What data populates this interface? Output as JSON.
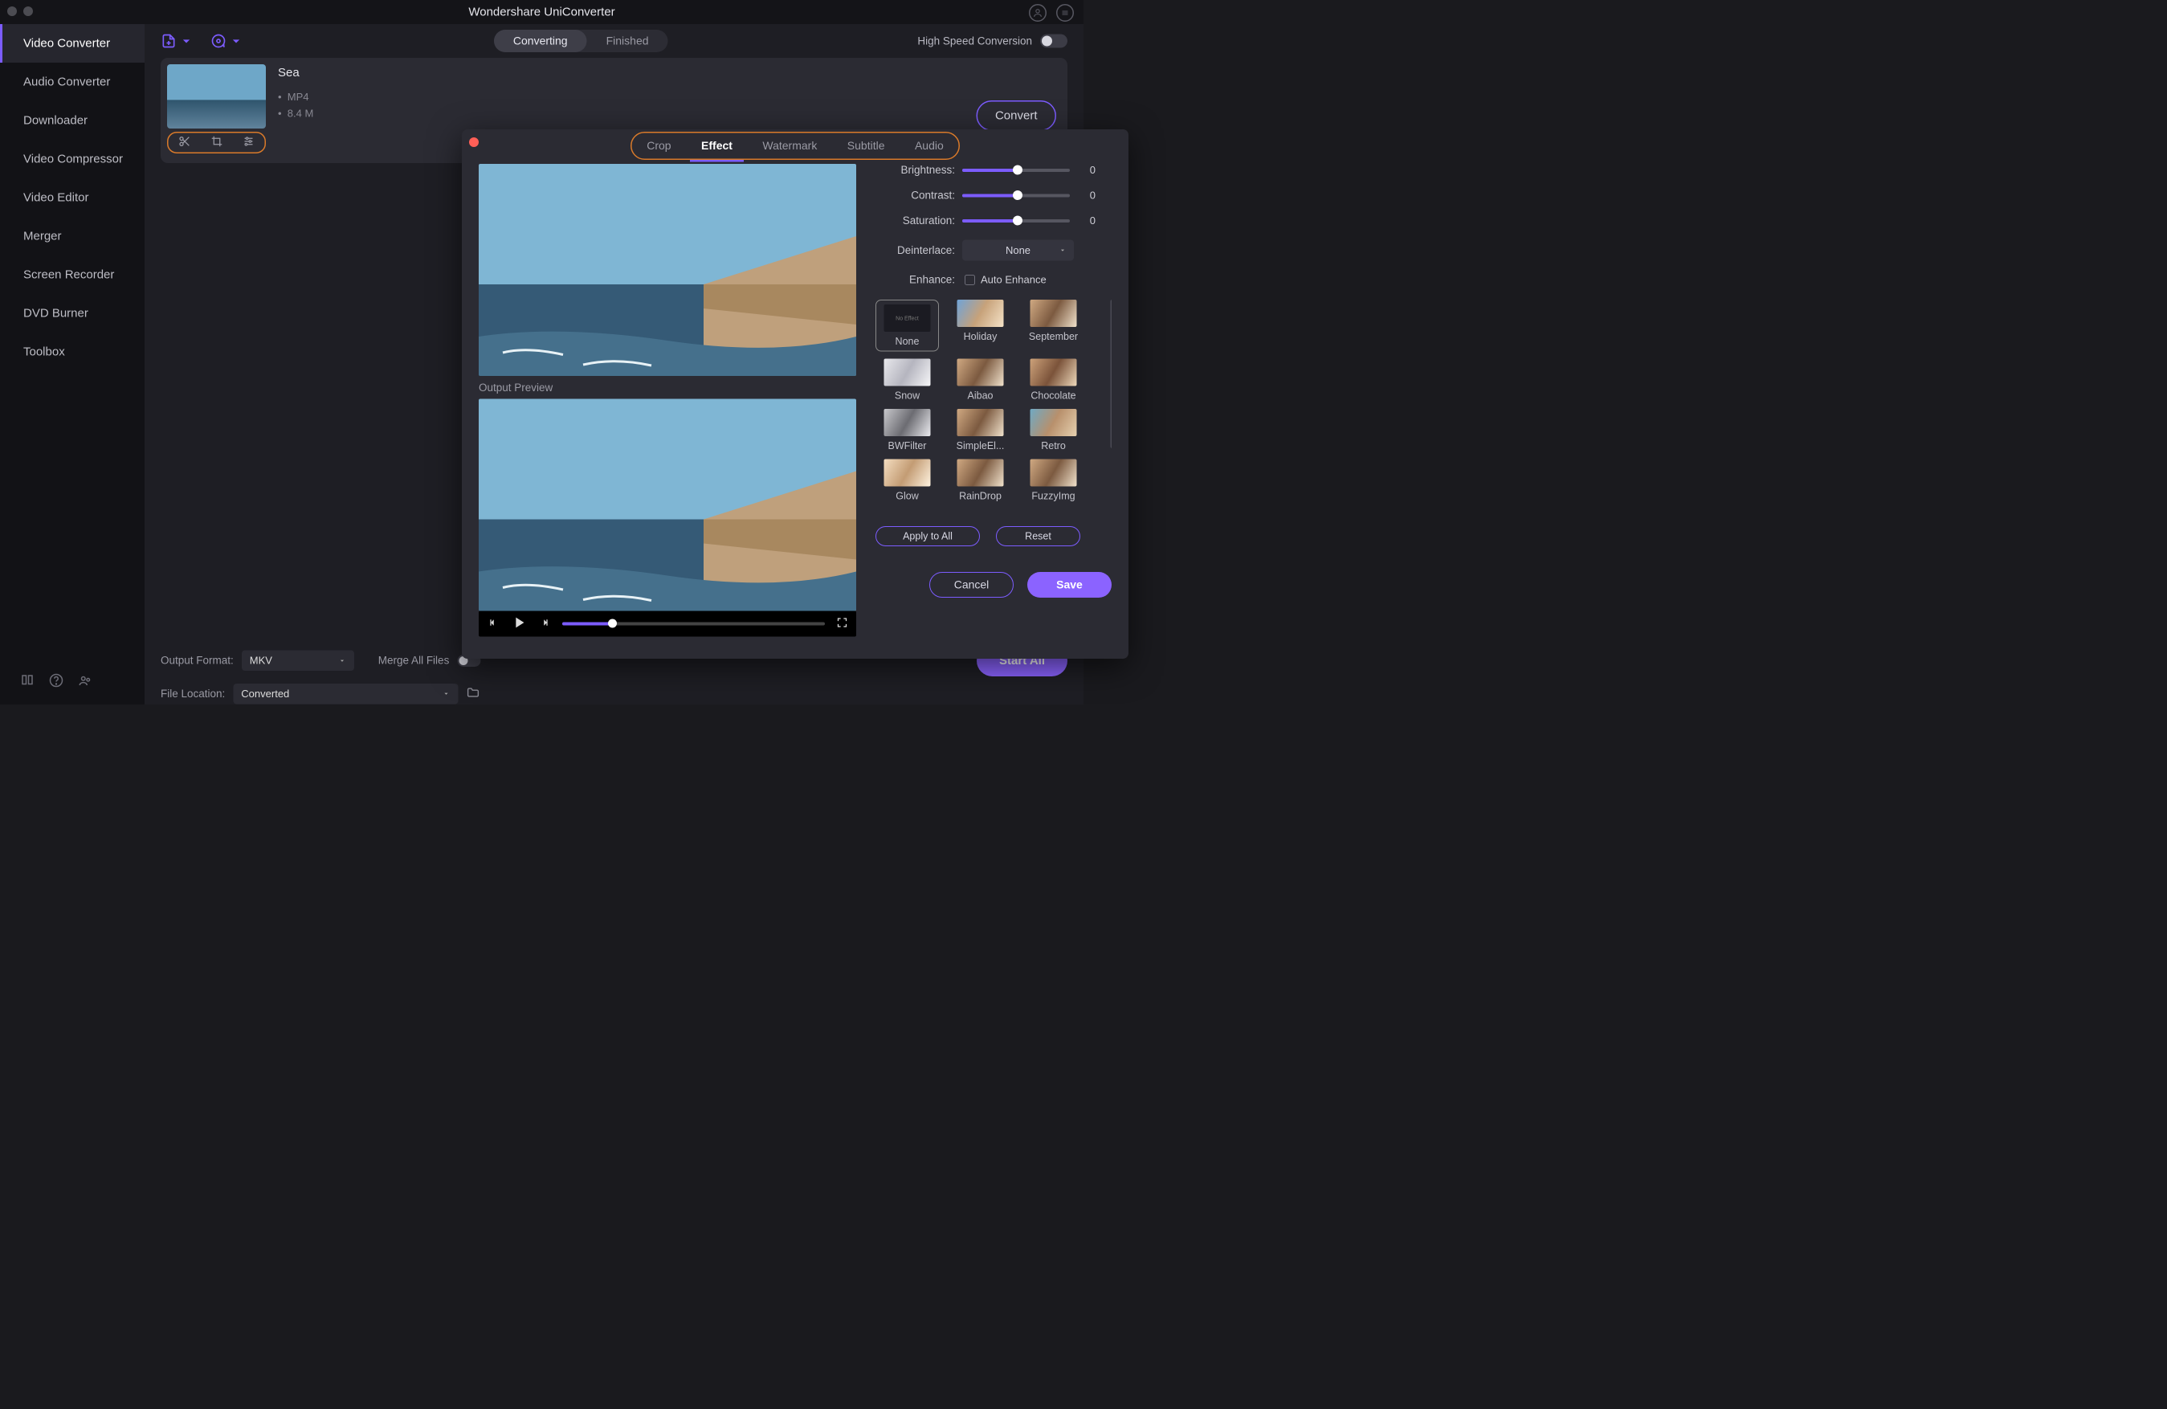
{
  "app": {
    "title": "Wondershare UniConverter"
  },
  "sidebar": {
    "items": [
      "Video Converter",
      "Audio Converter",
      "Downloader",
      "Video Compressor",
      "Video Editor",
      "Merger",
      "Screen Recorder",
      "DVD Burner",
      "Toolbox"
    ]
  },
  "topbar": {
    "seg": {
      "a": "Converting",
      "b": "Finished"
    },
    "hsc": "High Speed Conversion"
  },
  "file": {
    "title": "Sea",
    "meta1": "MP4",
    "meta2": "8.4 M",
    "convert": "Convert"
  },
  "bottom": {
    "output_format_label": "Output Format:",
    "output_format_value": "MKV",
    "merge_label": "Merge All Files",
    "location_label": "File Location:",
    "location_value": "Converted",
    "start_all": "Start All"
  },
  "dialog": {
    "tabs": {
      "crop": "Crop",
      "effect": "Effect",
      "watermark": "Watermark",
      "subtitle": "Subtitle",
      "audio": "Audio"
    },
    "output_preview": "Output Preview",
    "controls": {
      "brightness_label": "Brightness:",
      "brightness_val": "0",
      "contrast_label": "Contrast:",
      "contrast_val": "0",
      "saturation_label": "Saturation:",
      "saturation_val": "0",
      "deinterlace_label": "Deinterlace:",
      "deinterlace_value": "None",
      "enhance_label": "Enhance:",
      "auto_enhance": "Auto Enhance"
    },
    "effects": [
      "None",
      "Holiday",
      "September",
      "Snow",
      "Aibao",
      "Chocolate",
      "BWFilter",
      "SimpleEl...",
      "Retro",
      "Glow",
      "RainDrop",
      "FuzzyImg"
    ],
    "apply_to_all": "Apply to All",
    "reset": "Reset",
    "cancel": "Cancel",
    "save": "Save",
    "fx_none_thumb": "No Effect"
  }
}
